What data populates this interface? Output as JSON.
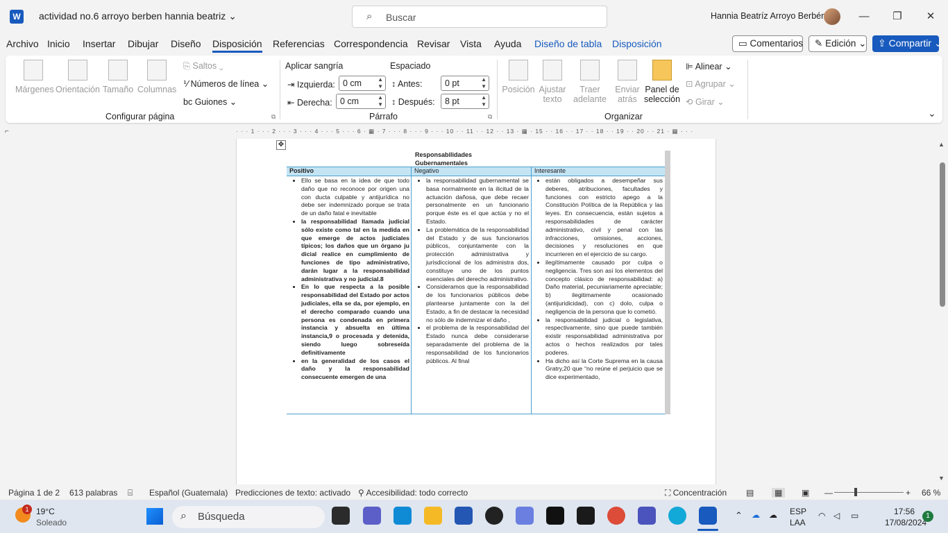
{
  "titlebar": {
    "app_logo": "W",
    "doc_title": "actividad no.6 arroyo berben hannia beatriz",
    "search_placeholder": "Buscar",
    "user_name": "Hannia Beatríz Arroyo  Berbén"
  },
  "menu": {
    "items": [
      "Archivo",
      "Inicio",
      "Insertar",
      "Dibujar",
      "Diseño",
      "Disposición",
      "Referencias",
      "Correspondencia",
      "Revisar",
      "Vista",
      "Ayuda"
    ],
    "context_items": [
      "Diseño de tabla",
      "Disposición"
    ],
    "comments": "Comentarios",
    "editing": "Edición",
    "share": "Compartir"
  },
  "ribbon": {
    "page_setup": {
      "margins": "Márgenes",
      "orientation": "Orientación",
      "size": "Tamaño",
      "columns": "Columnas",
      "breaks": "Saltos",
      "line_numbers": "Números de línea",
      "hyphenation": "Guiones",
      "label": "Configurar página"
    },
    "paragraph": {
      "indent_title": "Aplicar sangría",
      "spacing_title": "Espaciado",
      "left_label": "Izquierda:",
      "left_value": "0 cm",
      "right_label": "Derecha:",
      "right_value": "0 cm",
      "before_label": "Antes:",
      "before_value": "0 pt",
      "after_label": "Después:",
      "after_value": "8 pt",
      "label": "Párrafo"
    },
    "arrange": {
      "position": "Posición",
      "wrap_1": "Ajustar",
      "wrap_2": "texto",
      "forward_1": "Traer",
      "forward_2": "adelante",
      "backward_1": "Enviar",
      "backward_2": "atrás",
      "selection_1": "Panel de",
      "selection_2": "selección",
      "align": "Alinear",
      "group": "Agrupar",
      "rotate": "Girar",
      "label": "Organizar"
    }
  },
  "ruler": "· · · 1 · · · 2 · · · 3 · · · 4 · · · 5 · · · 6 · ▦ · 7 · · · 8 · · · 9 · · · 10 · · 11 · · 12 · · 13 · ▦ · 15 · · 16 · · 17 · · 18 · · 19 · · 20 · · 21 · ▦ · · ·",
  "table": {
    "caption_1": "Responsabilidades",
    "caption_2": "Gubernamentales",
    "headers": [
      "Positivo",
      "Negativo",
      "Interesante"
    ],
    "positivo": [
      "Ello se basa en la idea de que todo daño que no reconoce por origen una con ducta culpable y antijurídica no debe ser indemnizado porque se trata de un daño fatal e inevitable",
      "la responsabilidad llamada judicial sólo existe como tal en la medida en que emerge de actos judiciales típicos; los daños que un órgano ju dicial realice en cumplimiento de funciones de tipo administrativo, darán lugar a la responsabilidad administrativa y no judicial.8",
      "En lo que respecta a la posible responsabilidad del Estado por actos judiciales, ella se da, por ejemplo, en el derecho comparado cuando una persona es condenada en primera instancia y absuelta en última instancia,9 o procesada y detenida, siendo luego sobreseída definitivamente",
      "en la generalidad de los casos el daño y la responsabilidad consecuente emergen de una"
    ],
    "negativo": [
      "la responsabilidad gubernamental se basa normalmente en la ilicitud de la actuación dañosa, que debe recaer personalmente en un funcionario porque éste es el que actúa y no el Estado.",
      "La problemática de la responsabilidad del Estado y de sus funcionarios públicos, conjuntamente con la protección administrativa y jurisdiccional de los administra dos, constituye uno de los puntos esenciales del derecho administrativo.",
      "Consideramos que la responsabilidad de los funcionarios públicos debe plantearse juntamente con la del Estado, a fin de destacar la necesidad no sólo de indemnizar el daño ,",
      "el problema de la responsabilidad del Estado nunca debe considerarse separadamente del problema de la responsabilidad de los funcionarios públicos. Al final"
    ],
    "interesante": [
      "están obligados a desempeñar sus deberes, atribuciones, facultades y funciones con estricto apego a la Constitución Política de la República y las leyes. En consecuencia, están sujetos a responsabilidades de carácter administrativo, civil y penal con las infracciones, omisiones, acciones, decisiones y resoluciones en que incurrieren en el ejercicio de su cargo.",
      "ilegítimamente causado por culpa o negligencia. Tres son así los elementos del concepto clásico de responsabilidad: a) Daño material, pecuniariamente apreciable; b) ilegitimamente ocasionado (antijuridicidad), con c) dolo, culpa o negligencia de la persona que lo cometió.",
      "la responsabilidad judicial o legislativa, respectivamente, sino que puede también existir responsabilidad administrativa por actos o hechos realizados por tales poderes.",
      "Ha dicho así la Corte Suprema en la causa Gratry,20 que “no reúne el perjuicio que se dice experimentado,"
    ]
  },
  "statusbar": {
    "page": "Página 1 de 2",
    "words": "613 palabras",
    "language": "Español (Guatemala)",
    "predictions": "Predicciones de texto: activado",
    "accessibility": "Accesibilidad: todo correcto",
    "focus": "Concentración",
    "zoom": "66 %"
  },
  "taskbar": {
    "weather_badge": "1",
    "temperature": "19°C",
    "weather": "Soleado",
    "search": "Búsqueda",
    "lang_1": "ESP",
    "lang_2": "LAA",
    "time": "17:56",
    "date": "17/08/2024",
    "notif": "1"
  },
  "colors": {
    "accent": "#185abd",
    "table_header": "#c4e4f4",
    "table_border": "#4aa0cf"
  }
}
